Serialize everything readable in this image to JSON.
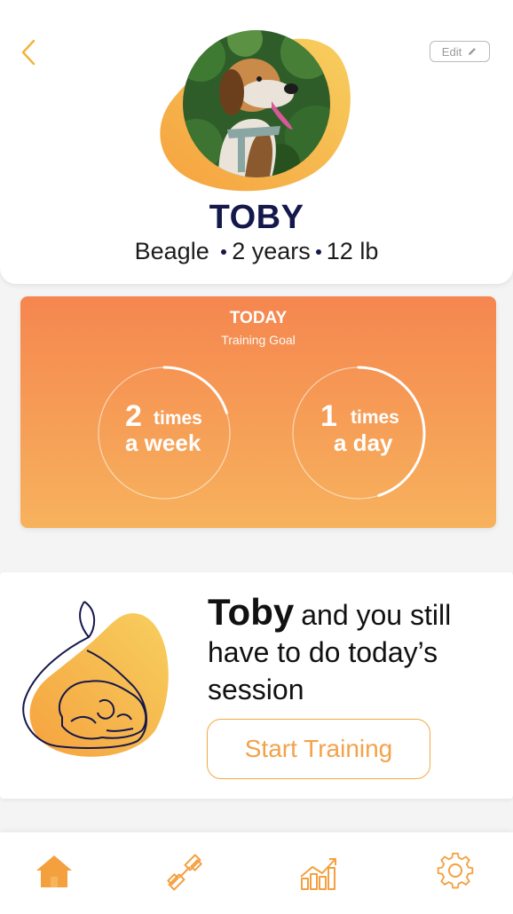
{
  "header": {
    "edit_label": "Edit"
  },
  "pet": {
    "name": "TOBY",
    "breed": "Beagle",
    "age": "2 years",
    "weight": "12 lb"
  },
  "goal": {
    "title": "TODAY",
    "subtitle": "Training Goal",
    "weekly": {
      "number": "2",
      "unit": "times",
      "frequency": "a week",
      "progress": 0.2
    },
    "daily": {
      "number": "1",
      "unit": "times",
      "frequency": "a day",
      "progress": 0.45
    }
  },
  "training": {
    "name": "Toby",
    "message": "and you still have to do today’s session",
    "button_label": "Start Training"
  },
  "nav": {
    "items": [
      "home-icon",
      "dumbbell-icon",
      "chart-icon",
      "settings-icon"
    ],
    "active": "home-icon"
  },
  "colors": {
    "accent": "#f3a24a",
    "navy": "#15184a",
    "gradient_top": "#f5864f",
    "gradient_bottom": "#f7b25d"
  }
}
